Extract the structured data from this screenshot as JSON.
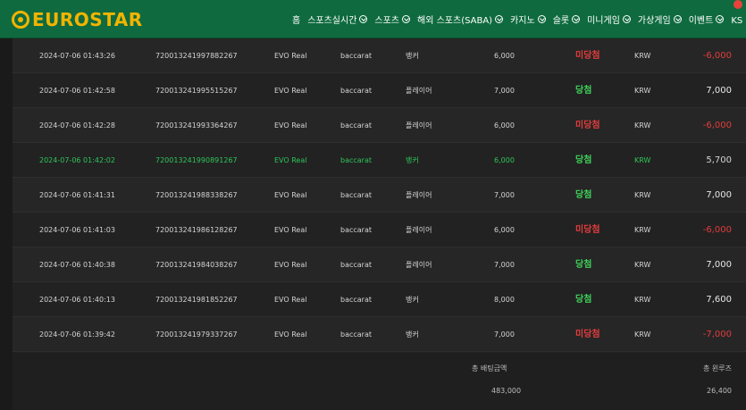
{
  "brand": {
    "logo_text": "EUROSTAR"
  },
  "nav": [
    {
      "label": "홈",
      "has_chevron": false
    },
    {
      "label": "스포츠실시간",
      "has_chevron": true
    },
    {
      "label": "스포츠",
      "has_chevron": true
    },
    {
      "label": "해외 스포츠(SABA)",
      "has_chevron": true
    },
    {
      "label": "카지노",
      "has_chevron": true
    },
    {
      "label": "슬롯",
      "has_chevron": true
    },
    {
      "label": "미니게임",
      "has_chevron": true
    },
    {
      "label": "가상게임",
      "has_chevron": true
    },
    {
      "label": "이벤트",
      "has_chevron": true
    },
    {
      "label": "KS 바로가기",
      "has_chevron": false
    }
  ],
  "rows": [
    {
      "date": "2024-07-06 01:43:26",
      "id": "720013241997882267",
      "provider": "EVO Real",
      "game": "baccarat",
      "pick": "뱅커",
      "bet": "6,000",
      "result": "미당첨",
      "currency": "KRW",
      "win": "-6,000",
      "win_type": "neg",
      "highlight": false
    },
    {
      "date": "2024-07-06 01:42:58",
      "id": "720013241995515267",
      "provider": "EVO Real",
      "game": "baccarat",
      "pick": "플레이어",
      "bet": "7,000",
      "result": "당첨",
      "currency": "KRW",
      "win": "7,000",
      "win_type": "pos",
      "highlight": false
    },
    {
      "date": "2024-07-06 01:42:28",
      "id": "720013241993364267",
      "provider": "EVO Real",
      "game": "baccarat",
      "pick": "플레이어",
      "bet": "6,000",
      "result": "미당첨",
      "currency": "KRW",
      "win": "-6,000",
      "win_type": "neg",
      "highlight": false
    },
    {
      "date": "2024-07-06 01:42:02",
      "id": "720013241990891267",
      "provider": "EVO Real",
      "game": "baccarat",
      "pick": "뱅커",
      "bet": "6,000",
      "result": "당첨",
      "currency": "KRW",
      "win": "5,700",
      "win_type": "pos",
      "highlight": true
    },
    {
      "date": "2024-07-06 01:41:31",
      "id": "720013241988338267",
      "provider": "EVO Real",
      "game": "baccarat",
      "pick": "플레이어",
      "bet": "7,000",
      "result": "당첨",
      "currency": "KRW",
      "win": "7,000",
      "win_type": "pos",
      "highlight": false
    },
    {
      "date": "2024-07-06 01:41:03",
      "id": "720013241986128267",
      "provider": "EVO Real",
      "game": "baccarat",
      "pick": "플레이어",
      "bet": "6,000",
      "result": "미당첨",
      "currency": "KRW",
      "win": "-6,000",
      "win_type": "neg",
      "highlight": false
    },
    {
      "date": "2024-07-06 01:40:38",
      "id": "720013241984038267",
      "provider": "EVO Real",
      "game": "baccarat",
      "pick": "플레이어",
      "bet": "7,000",
      "result": "당첨",
      "currency": "KRW",
      "win": "7,000",
      "win_type": "pos",
      "highlight": false
    },
    {
      "date": "2024-07-06 01:40:13",
      "id": "720013241981852267",
      "provider": "EVO Real",
      "game": "baccarat",
      "pick": "뱅커",
      "bet": "8,000",
      "result": "당첨",
      "currency": "KRW",
      "win": "7,600",
      "win_type": "pos",
      "highlight": false
    },
    {
      "date": "2024-07-06 01:39:42",
      "id": "720013241979337267",
      "provider": "EVO Real",
      "game": "baccarat",
      "pick": "뱅커",
      "bet": "7,000",
      "result": "미당첨",
      "currency": "KRW",
      "win": "-7,000",
      "win_type": "neg",
      "highlight": false
    }
  ],
  "totals": {
    "bet_label": "총 배팅금액",
    "bet_value": "483,000",
    "win_label": "총 윈루즈",
    "win_value": "26,400"
  },
  "colors": {
    "header_bg": "#0f6b3f",
    "logo": "#f2b400",
    "win": "#3fd25a",
    "lose": "#e23c3c",
    "highlight_row": "#2fc45a"
  }
}
